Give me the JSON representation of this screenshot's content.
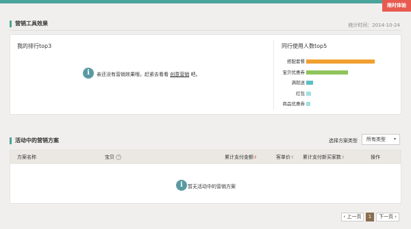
{
  "colors": {
    "accent": "#4aa49c",
    "badge": "#e85a4f",
    "info_icon": "#5a9aa2",
    "page_current": "#8a6d4e"
  },
  "badge": {
    "label": "限时体验"
  },
  "effect": {
    "title": "营销工具效果",
    "stat_time": "统计时间：2014-10-24",
    "ranking": {
      "title": "我的排行top3",
      "empty_prefix": "亲还没有营销效果哦，赶紧去看看",
      "empty_link": "创意营销",
      "empty_suffix": "吧。"
    },
    "peer": {
      "title": "同行使用人数top5"
    }
  },
  "chart_data": {
    "type": "bar",
    "orientation": "horizontal",
    "categories": [
      "搭配套餐",
      "宝贝优惠券",
      "满就送",
      "红包",
      "商品优惠券"
    ],
    "values": [
      100,
      61,
      10,
      7,
      6
    ],
    "colors": [
      "#f0a030",
      "#8fc45a",
      "#5bbfc4",
      "#9fe0e0",
      "#9fe0e0"
    ],
    "grid": false
  },
  "activity": {
    "title": "活动中的营销方案",
    "filter_label": "选择方案类型",
    "filter_value": "所有类型",
    "columns": {
      "name": "方案名称",
      "item": "宝贝",
      "total_amount": "累计支付金额",
      "unit_price": "客单价",
      "new_buyers": "累计支付新买家数",
      "action": "操作"
    },
    "empty_text": "暂无活动中的营销方案"
  },
  "pager": {
    "prev": "上一页",
    "current": "1",
    "next": "下一页"
  }
}
